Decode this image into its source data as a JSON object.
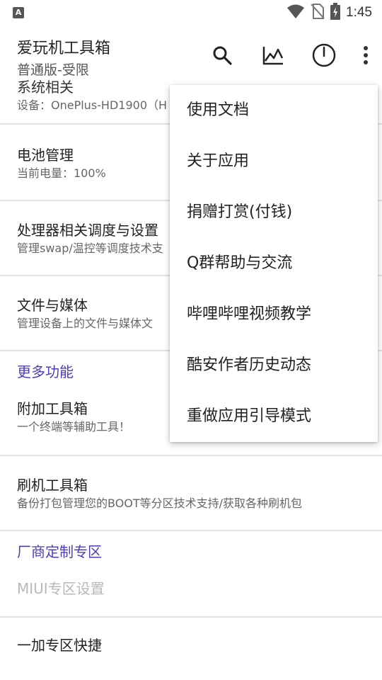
{
  "status_bar": {
    "time": "1:45",
    "notification_icon_letter": "A",
    "icons": [
      "wifi-icon",
      "no-sim-icon",
      "battery-charging-icon"
    ]
  },
  "app_bar": {
    "title": "爱玩机工具箱",
    "subtitle": "普通版-受限",
    "actions": [
      "search-icon",
      "chart-icon",
      "power-icon",
      "more-vert-icon"
    ]
  },
  "list": {
    "system": {
      "title": "系统相关",
      "subtitle": "设备：OnePlus-HD1900（H"
    },
    "battery": {
      "title": "电池管理",
      "subtitle": "当前电量：100%"
    },
    "cpu": {
      "title": "处理器相关调度与设置",
      "subtitle": "管理swap/温控等调度技术支"
    },
    "files": {
      "title": "文件与媒体",
      "subtitle": "管理设备上的文件与媒体文"
    },
    "more_section": "更多功能",
    "extra_tools": {
      "title": "附加工具箱",
      "subtitle": "一个终端等辅助工具！"
    },
    "flash_tools": {
      "title": "刷机工具箱",
      "subtitle": "备份打包管理您的BOOT等分区技术支持/获取各种刷机包"
    },
    "vendor_section": "厂商定制专区",
    "miui": {
      "title": "MIUI专区设置"
    },
    "oneplus": {
      "title": "一加专区快捷"
    }
  },
  "menu": {
    "items": [
      "使用文档",
      "关于应用",
      "捐赠打赏(付钱)",
      "Q群帮助与交流",
      "哔哩哔哩视频教学",
      "酷安作者历史动态",
      "重做应用引导模式"
    ]
  },
  "colors": {
    "accent": "#4a3fb8",
    "divider": "#e3e3e3",
    "disabled_text": "#b8b8b8"
  }
}
